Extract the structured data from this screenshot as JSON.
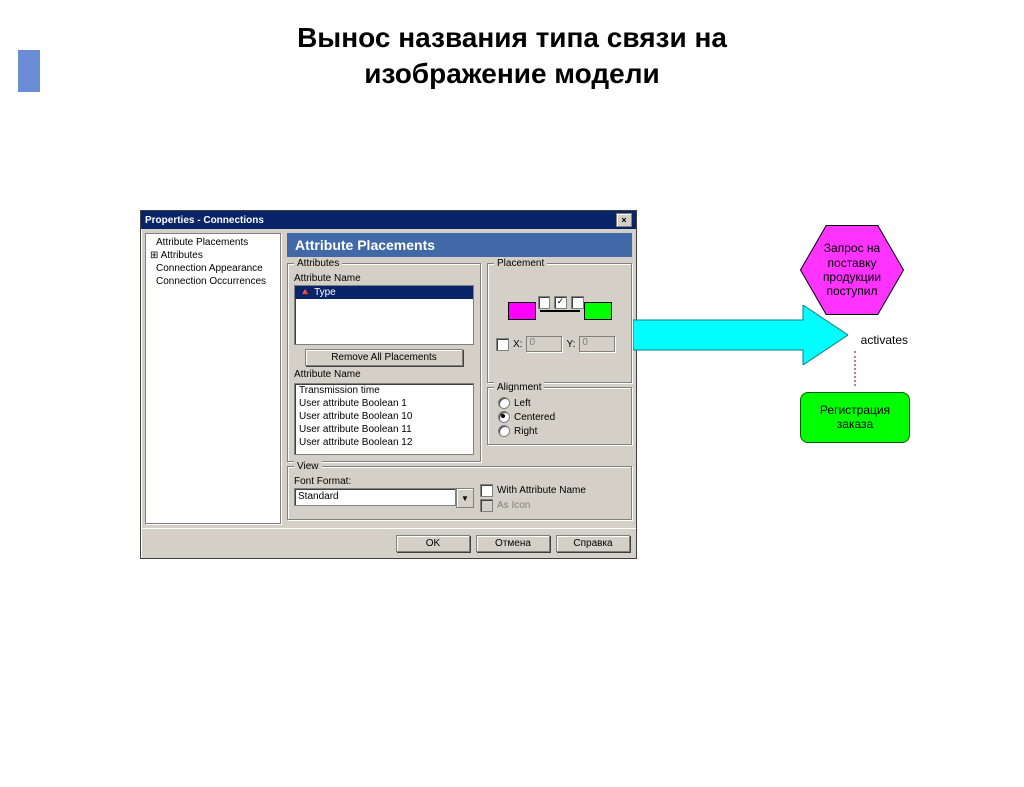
{
  "slide": {
    "title_line1": "Вынос названия типа связи на",
    "title_line2": "изображение модели"
  },
  "dialog": {
    "title": "Properties - Connections",
    "panel_header": "Attribute Placements",
    "tree": [
      "Attribute Placements",
      "Attributes",
      "Connection Appearance",
      "Connection Occurrences"
    ],
    "attributes_group": "Attributes",
    "attribute_name_label": "Attribute Name",
    "selected_attr": "Type",
    "remove_btn": "Remove All Placements",
    "attr_list": [
      "Transmission time",
      "User attribute Boolean 1",
      "User attribute Boolean 10",
      "User attribute Boolean 11",
      "User attribute Boolean 12"
    ],
    "placement_group": "Placement",
    "x_label": "X:",
    "y_label": "Y:",
    "x_val": "0",
    "y_val": "0",
    "alignment_group": "Alignment",
    "align_left": "Left",
    "align_center": "Centered",
    "align_right": "Right",
    "view_group": "View",
    "font_format_label": "Font Format:",
    "font_format_value": "Standard",
    "with_attr_name": "With Attribute Name",
    "as_icon": "As Icon",
    "ok_btn": "OK",
    "cancel_btn": "Отмена",
    "help_btn": "Справка"
  },
  "model": {
    "hex_text": "Запрос на поставку продукции поступил",
    "activates": "activates",
    "func_text": "Регистрация заказа"
  }
}
